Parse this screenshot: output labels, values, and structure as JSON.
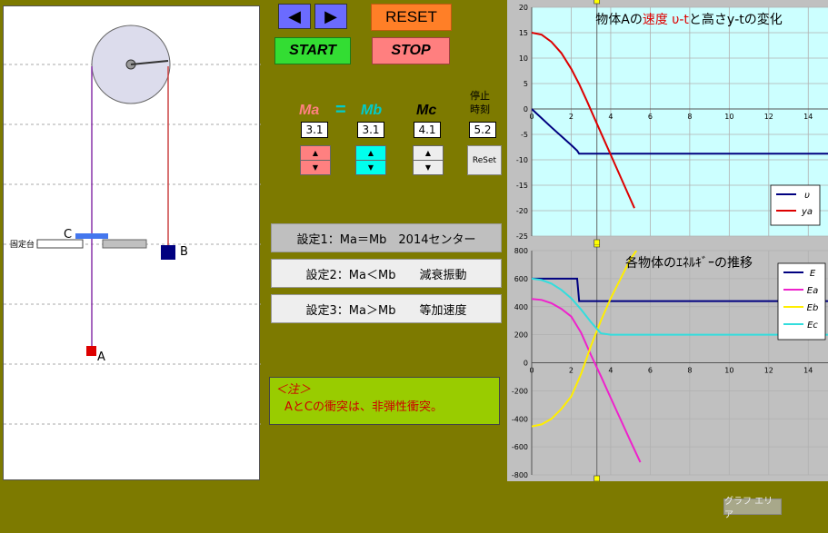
{
  "nav": {
    "prev_label": "◀",
    "next_label": "▶"
  },
  "controls": {
    "reset_label": "RESET",
    "start_label": "START",
    "stop_label": "STOP"
  },
  "masses": {
    "ma_label": "Ma",
    "eq_label": "=",
    "mb_label": "Mb",
    "mc_label": "Mc",
    "ma_value": "3.1",
    "mb_value": "3.1",
    "mc_value": "4.1",
    "ma_color": "#ff8080",
    "mb_color": "#00cccc",
    "mc_color": "#000000"
  },
  "stop_time": {
    "label_line1": "停止",
    "label_line2": "時刻",
    "value": "5.2",
    "reset_label": "ReSet"
  },
  "presets": [
    {
      "label": "設定1：Ma＝Mb　2014センター"
    },
    {
      "label": "設定2：Ma＜Mb　　減衰振動"
    },
    {
      "label": "設定3：Ma＞Mb　　等加速度"
    }
  ],
  "note": {
    "title": "＜注＞",
    "text": "AとCの衝突は、非弾性衝突。"
  },
  "simulation": {
    "fixed_label": "固定台",
    "label_a": "A",
    "label_b": "B",
    "label_c": "C",
    "colors": {
      "a": "#dd0000",
      "b": "#000080",
      "c": "#4477ee",
      "pulley": "#dcdcec"
    }
  },
  "graph_area_label": "グラフ エリア",
  "chart_data": [
    {
      "type": "line",
      "title": "物体Aの速度 υ‐tと高さy‐tの変化",
      "title_parts": [
        {
          "text": "物体Aの",
          "color": "#000000"
        },
        {
          "text": "速度",
          "color": "#dd0000"
        },
        {
          "text": " υ‐t",
          "color": "#dd0000"
        },
        {
          "text": "と高さ",
          "color": "#000000"
        },
        {
          "text": "y‐t",
          "color": "#000000"
        },
        {
          "text": "の変化",
          "color": "#000000"
        }
      ],
      "xlim": [
        0,
        15
      ],
      "ylim": [
        -25,
        20
      ],
      "xticks": [
        0,
        2,
        4,
        6,
        8,
        10,
        12,
        14
      ],
      "yticks": [
        20,
        15,
        10,
        5,
        0,
        -5,
        -10,
        -15,
        -20,
        -25
      ],
      "grid": true,
      "background": "#ccffff",
      "legend": "bottom-right",
      "marker_x": 3.3,
      "series": [
        {
          "name": "υ",
          "color": "#000080",
          "x": [
            0,
            1,
            2,
            2.3,
            2.4,
            3,
            4,
            6,
            8,
            10,
            12,
            14,
            15
          ],
          "y": [
            0,
            -3.6,
            -7.1,
            -8.2,
            -8.8,
            -8.8,
            -8.8,
            -8.8,
            -8.8,
            -8.8,
            -8.8,
            -8.8,
            -8.8
          ]
        },
        {
          "name": "ya",
          "color": "#dd0000",
          "x": [
            0,
            0.5,
            1,
            1.5,
            2,
            2.4,
            2.8,
            3.2,
            3.6,
            4,
            4.4,
            4.8,
            5.2
          ],
          "y": [
            15,
            14.6,
            13.2,
            11,
            7.9,
            4.9,
            1.5,
            -2,
            -5.5,
            -9,
            -12.5,
            -16,
            -19.5
          ]
        }
      ]
    },
    {
      "type": "line",
      "title": "各物体のｴﾈﾙｷﾞｰの推移",
      "xlim": [
        0,
        15
      ],
      "ylim": [
        -800,
        800
      ],
      "xticks": [
        0,
        2,
        4,
        6,
        8,
        10,
        12,
        14
      ],
      "yticks": [
        800,
        600,
        400,
        200,
        0,
        -200,
        -400,
        -600,
        -800
      ],
      "grid": true,
      "background": "#c0c0c0",
      "legend": "top-right",
      "marker_x": 3.3,
      "series": [
        {
          "name": "E",
          "color": "#000080",
          "x": [
            0,
            2.3,
            2.4,
            4,
            6,
            8,
            10,
            12,
            14,
            15
          ],
          "y": [
            600,
            600,
            440,
            440,
            440,
            440,
            440,
            440,
            440,
            440
          ]
        },
        {
          "name": "Ea",
          "color": "#ee22cc",
          "x": [
            0,
            0.5,
            1,
            1.5,
            2,
            2.5,
            3,
            3.5,
            4,
            4.5,
            5,
            5.5
          ],
          "y": [
            455,
            448,
            425,
            385,
            330,
            215,
            55,
            -95,
            -250,
            -405,
            -560,
            -710
          ]
        },
        {
          "name": "Eb",
          "color": "#ffee00",
          "x": [
            0,
            0.5,
            1,
            1.5,
            2,
            2.5,
            3,
            3.5,
            4,
            4.5,
            5,
            5.3
          ],
          "y": [
            -455,
            -440,
            -400,
            -330,
            -240,
            -80,
            120,
            300,
            460,
            600,
            740,
            800
          ]
        },
        {
          "name": "Ec",
          "color": "#33dddd",
          "x": [
            0,
            0.5,
            1,
            1.5,
            2,
            2.5,
            3,
            3.5,
            4,
            6,
            8,
            10,
            12,
            14,
            15
          ],
          "y": [
            600,
            590,
            565,
            520,
            460,
            380,
            290,
            210,
            200,
            200,
            200,
            200,
            200,
            200,
            200
          ]
        }
      ]
    }
  ]
}
